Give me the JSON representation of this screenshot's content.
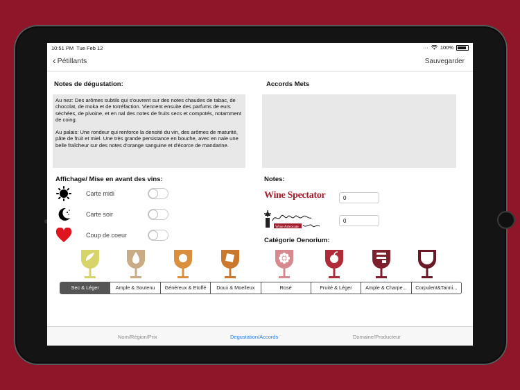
{
  "status": {
    "time": "10:51 PM",
    "date": "Tue Feb 12",
    "battery": "100%"
  },
  "nav": {
    "back_label": "Pétillants",
    "save_label": "Sauvegarder"
  },
  "tasting": {
    "title": "Notes de dégustation:",
    "nez": "Au nez: Des arômes subtils qui s'ouvrent sur des notes chaudes de tabac, de chocolat, de moka et de torréfaction. Viennent ensuite des parfums de eurs séchées, de pivoine, et en nal des notes de fruits secs et compotés, notamment de coing.",
    "palais": "Au palais: Une rondeur qui renforce la densité du vin, des arômes de maturité, pâte de fruit et miel. Une très grande persistance en bouche, avec en nale une belle fraîcheur sur des notes d'orange sanguine et d'écorce de mandarine."
  },
  "accords": {
    "title": "Accords Mets"
  },
  "display": {
    "title": "Affichage/ Mise en avant des vins:",
    "items": [
      {
        "label": "Carte midi",
        "icon": "sun-icon"
      },
      {
        "label": "Carte soir",
        "icon": "moon-icon"
      },
      {
        "label": "Coup de coeur",
        "icon": "heart-icon"
      }
    ]
  },
  "notes": {
    "title": "Notes:",
    "wine_spectator": "Wine Spectator",
    "wine_advocate": "Wine Advocate",
    "ws_value": "0",
    "rp_value": "0"
  },
  "categorie": {
    "title": "Catégorie Oenorium:",
    "segments": [
      "Sec & Léger",
      "Ample & Soutenu",
      "Généreux & Etoffé",
      "Doux & Moelleux",
      "Rosé",
      "Fruité & Léger",
      "Ample & Charpe...",
      "Corpulent&Tanni..."
    ],
    "selected": 0,
    "colors": [
      "#d7d46a",
      "#c9ab86",
      "#d98f3d",
      "#c9782e",
      "#d68a90",
      "#b12a3a",
      "#7d1f2c",
      "#6a1827"
    ]
  },
  "tabs": [
    "Nom/Région/Prix",
    "Degustation/Accords",
    "Domaine/Producteur"
  ],
  "active_tab": 1
}
